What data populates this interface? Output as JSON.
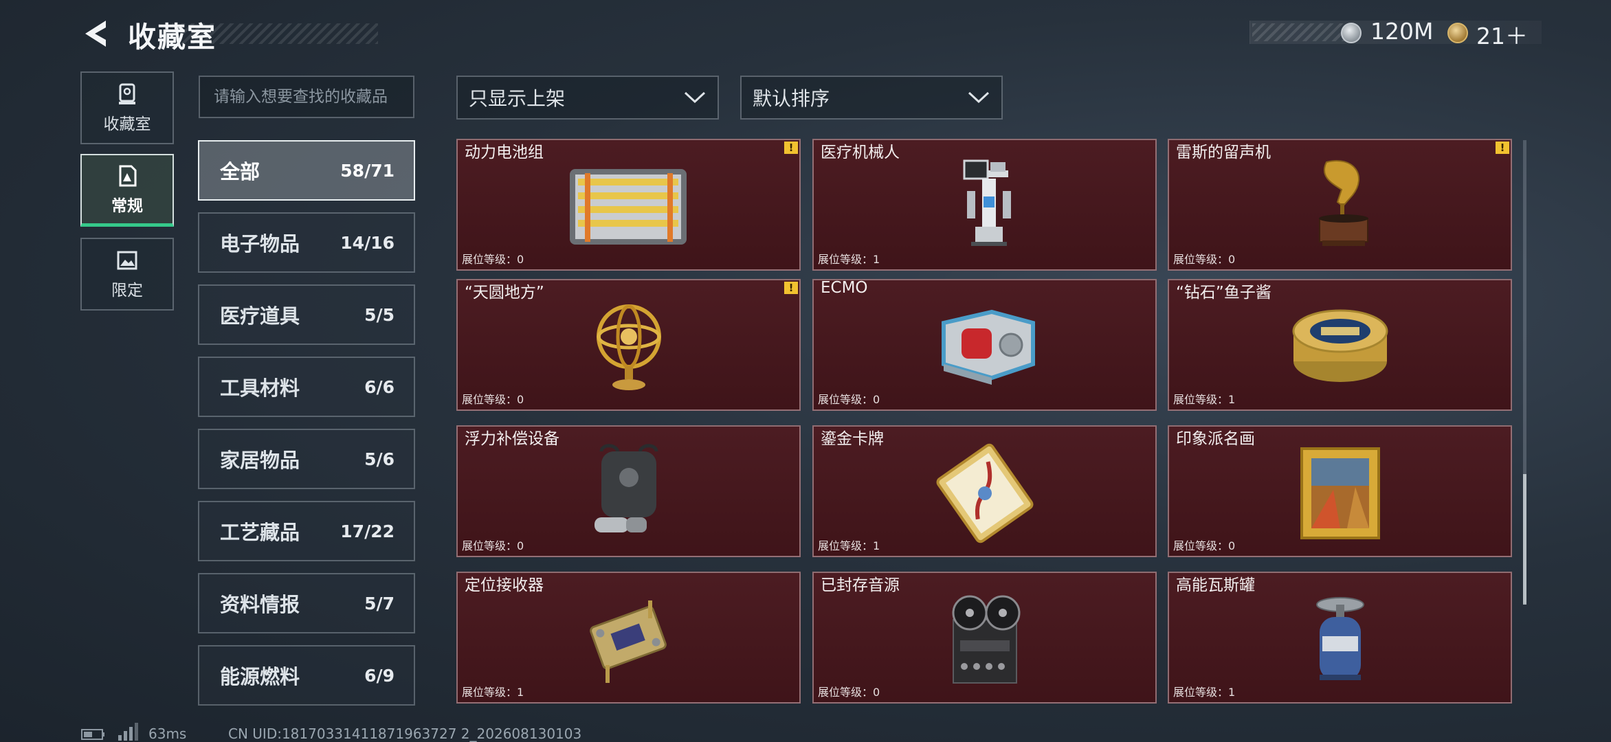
{
  "header": {
    "title": "收藏室",
    "back_icon": "back-arrow-icon"
  },
  "currency": [
    {
      "icon": "silver-coin-icon",
      "value": "120M"
    },
    {
      "icon": "gold-token-icon",
      "value": "21＋"
    }
  ],
  "side_tabs": [
    {
      "label": "收藏室",
      "icon": "trophy-icon",
      "active": false
    },
    {
      "label": "常规",
      "icon": "document-icon",
      "active": true
    },
    {
      "label": "限定",
      "icon": "image-icon",
      "active": false
    }
  ],
  "search": {
    "placeholder": "请输入想要查找的收藏品",
    "value": ""
  },
  "filter_dropdown": {
    "selected": "只显示上架"
  },
  "sort_dropdown": {
    "selected": "默认排序"
  },
  "categories": [
    {
      "name": "全部",
      "count": "58/71",
      "active": true
    },
    {
      "name": "电子物品",
      "count": "14/16"
    },
    {
      "name": "医疗道具",
      "count": "5/5"
    },
    {
      "name": "工具材料",
      "count": "6/6"
    },
    {
      "name": "家居物品",
      "count": "5/6"
    },
    {
      "name": "工艺藏品",
      "count": "17/22"
    },
    {
      "name": "资料情报",
      "count": "5/7"
    },
    {
      "name": "能源燃料",
      "count": "6/9"
    }
  ],
  "items": [
    {
      "name": "动力电池组",
      "level": "展位等级：0",
      "warning": true,
      "art": "battery-pack-icon"
    },
    {
      "name": "医疗机械人",
      "level": "展位等级：1",
      "warning": false,
      "art": "medical-robot-icon"
    },
    {
      "name": "雷斯的留声机",
      "level": "展位等级：0",
      "warning": true,
      "art": "gramophone-icon"
    },
    {
      "name": "“天圆地方”",
      "level": "展位等级：0",
      "warning": true,
      "art": "armillary-sphere-icon"
    },
    {
      "name": "ECMO",
      "level": "展位等级：0",
      "warning": false,
      "art": "ecmo-machine-icon"
    },
    {
      "name": "“钻石”鱼子酱",
      "level": "展位等级：1",
      "warning": false,
      "art": "caviar-tin-icon"
    },
    {
      "name": "浮力补偿设备",
      "level": "展位等级：0",
      "warning": false,
      "art": "diving-bcd-icon"
    },
    {
      "name": "鎏金卡牌",
      "level": "展位等级：1",
      "warning": false,
      "art": "gilded-card-icon"
    },
    {
      "name": "印象派名画",
      "level": "展位等级：0",
      "warning": false,
      "art": "framed-painting-icon"
    },
    {
      "name": "定位接收器",
      "level": "展位等级：1",
      "warning": false,
      "art": "gps-receiver-icon"
    },
    {
      "name": "已封存音源",
      "level": "展位等级：0",
      "warning": false,
      "art": "reel-recorder-icon"
    },
    {
      "name": "高能瓦斯罐",
      "level": "展位等级：1",
      "warning": false,
      "art": "gas-canister-icon"
    }
  ],
  "status": {
    "ping": "63ms",
    "uid": "CN UID:18170331411871963727 2_202608130103"
  },
  "colors": {
    "card_bg": "#4c1c22",
    "accent_green": "#35c98a",
    "warning": "#f2c230"
  }
}
